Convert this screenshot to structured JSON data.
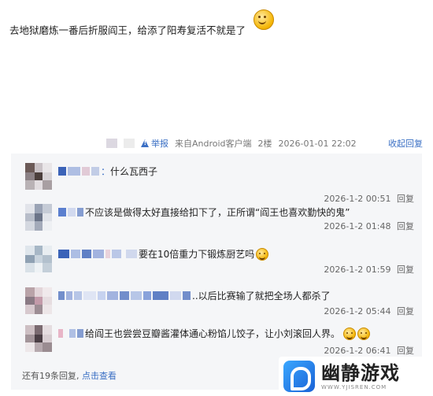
{
  "post": {
    "text": "去地狱磨炼一番后折服阎王，给添了阳寿复活不就是了",
    "emoji": "smile-emoji"
  },
  "meta": {
    "report_label": "举报",
    "source": "来自Android客户端",
    "floor": "2楼",
    "datetime": "2026-01-01 22:02",
    "collapse_label": "收起回复"
  },
  "replies": [
    {
      "text": "什么瓦西子",
      "prefix": "：",
      "time": "2026-1-2 00:51",
      "action": "回复"
    },
    {
      "text": "不应该是做得太好直接给扣下了，正所谓“阎王也喜欢勤快的鬼”",
      "prefix": "",
      "time": "2026-1-2 01:48",
      "action": "回复"
    },
    {
      "text": "要在10倍重力下锻炼厨艺吗",
      "prefix": "",
      "time": "2026-1-2 01:59",
      "action": "回复"
    },
    {
      "text": "以后比赛输了就把全场人都杀了",
      "prefix": "..",
      "time": "2026-1-2 05:44",
      "action": "回复"
    },
    {
      "text": "给阎王也尝尝豆瓣酱灌体通心粉馅儿饺子，让小刘滚回人界。",
      "prefix": "",
      "time": "2026-1-2 06:41",
      "action": "回复"
    }
  ],
  "more": {
    "count_text": "还有19条回复,",
    "link_text": "点击查看"
  },
  "watermark": {
    "title": "幽静游戏",
    "sub": "WWW.YJISREN.COM"
  },
  "colors": {
    "link": "#3a6fc4",
    "panel_bg": "#f5f6f8"
  }
}
